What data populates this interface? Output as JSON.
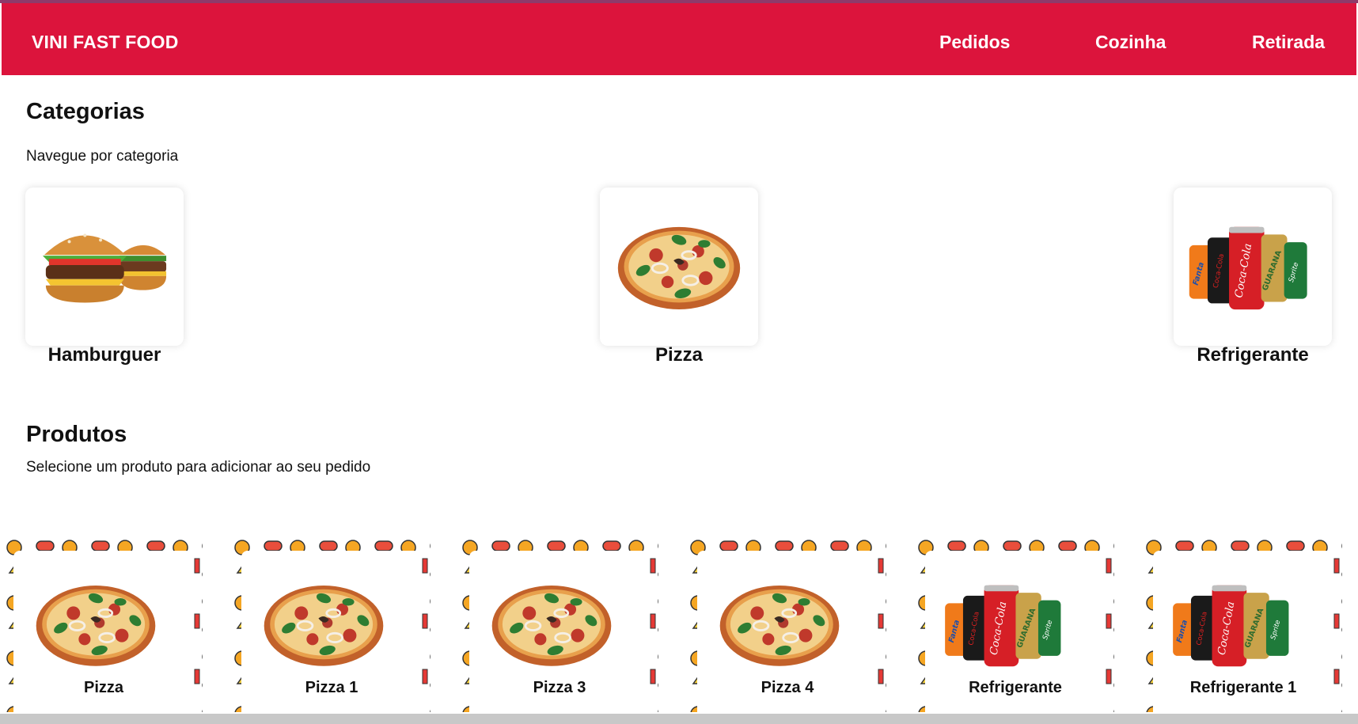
{
  "header": {
    "brand": "VINI FAST FOOD",
    "nav": [
      "Pedidos",
      "Cozinha",
      "Retirada"
    ],
    "color": "#dc143c"
  },
  "categories_section": {
    "title": "Categorias",
    "subtitle": "Navegue por categoria",
    "items": [
      {
        "label": "Hamburguer",
        "icon": "burger-image"
      },
      {
        "label": "Pizza",
        "icon": "pizza-image"
      },
      {
        "label": "Refrigerante",
        "icon": "soda-cans-image"
      }
    ]
  },
  "products_section": {
    "title": "Produtos",
    "subtitle": "Selecione um produto para adicionar ao seu pedido",
    "items": [
      {
        "label": "Pizza",
        "icon": "pizza-image"
      },
      {
        "label": "Pizza 1",
        "icon": "pizza-image"
      },
      {
        "label": "Pizza 3",
        "icon": "pizza-image"
      },
      {
        "label": "Pizza 4",
        "icon": "pizza-image"
      },
      {
        "label": "Refrigerante",
        "icon": "soda-cans-image"
      },
      {
        "label": "Refrigerante 1",
        "icon": "soda-cans-image"
      }
    ]
  }
}
